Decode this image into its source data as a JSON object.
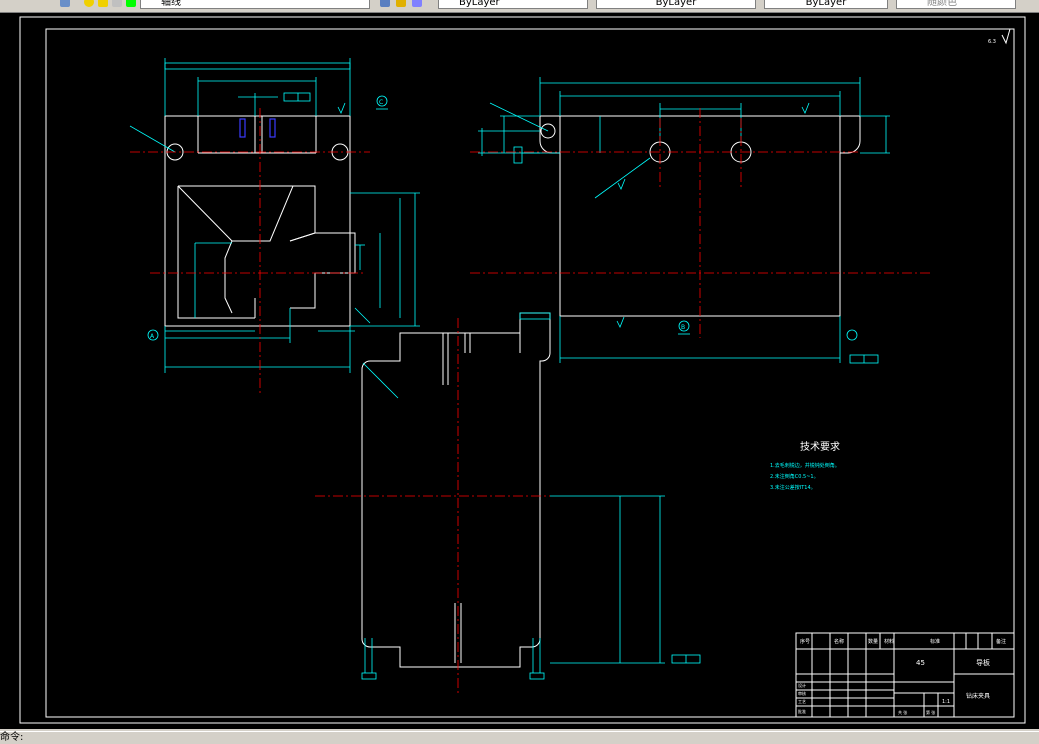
{
  "toolbar": {
    "layer_name": "轴线",
    "color_control": "ByLayer",
    "linetype_control": "ByLayer",
    "lineweight_control": "ByLayer",
    "plotstyle_control": "随颜色"
  },
  "drawing": {
    "tech_title": "技术要求",
    "tech_notes": [
      "1.去毛刺锐边，并锐钝处倒角。",
      "2.未注倒角C0.5~1。",
      "3.未注公差按IT14。"
    ],
    "title_block": {
      "material_label": "45",
      "part_name": "导板",
      "drawing_name": "钻床夹具",
      "scale": "1:1",
      "header_cells": [
        "序号",
        "名称",
        "数量",
        "材料",
        "标准",
        "备注"
      ],
      "row_labels": [
        "设计",
        "审核",
        "工艺",
        "批准"
      ],
      "sheet_label": "共 张",
      "sheet_label2": "第 张"
    },
    "view_labels": [
      "A",
      "B",
      "C"
    ],
    "roughness_mark": "6.3"
  },
  "statusbar": {
    "left_text": "命令:"
  },
  "colors": {
    "canvas": "#000000",
    "geometry": "#ffffff",
    "dimension": "#00ffff",
    "centerline": "#ff0000",
    "highlight": "#3b3bff"
  }
}
